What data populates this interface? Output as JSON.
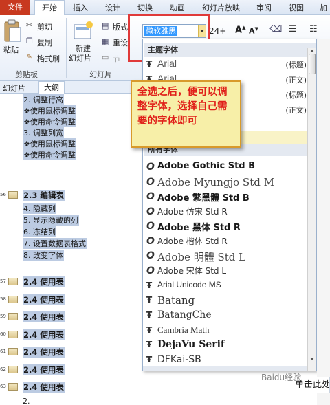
{
  "ribbon_tabs": [
    {
      "label": "文件"
    },
    {
      "label": "开始"
    },
    {
      "label": "插入"
    },
    {
      "label": "设计"
    },
    {
      "label": "切换"
    },
    {
      "label": "动画"
    },
    {
      "label": "幻灯片放映"
    },
    {
      "label": "审阅"
    },
    {
      "label": "视图"
    },
    {
      "label": "加"
    }
  ],
  "clipboard": {
    "paste": "粘贴",
    "cut": "剪切",
    "copy": "复制",
    "format_painter": "格式刷",
    "group": "剪贴板"
  },
  "slides_group": {
    "new_slide": "新建",
    "new_slide2": "幻灯片",
    "layout": "版式",
    "reset": "重设",
    "section": "节",
    "group": "幻灯片"
  },
  "font_box": {
    "value": "微软雅黑",
    "size": "24+"
  },
  "panel_tabs": {
    "slides": "幻灯片",
    "outline": "大纲"
  },
  "outline": [
    {
      "text": "2. 调整行高",
      "hl": true,
      "bold": false,
      "kind": "text"
    },
    {
      "text": "❖使用鼠标调整",
      "hl": true,
      "bold": false,
      "kind": "text"
    },
    {
      "text": "❖使用命令调整",
      "hl": true,
      "bold": false,
      "kind": "text"
    },
    {
      "text": "3. 调整列宽",
      "hl": true,
      "bold": false,
      "kind": "text"
    },
    {
      "text": "❖使用鼠标调整",
      "hl": true,
      "bold": false,
      "kind": "text"
    },
    {
      "text": "❖使用命令调整",
      "hl": true,
      "bold": false,
      "kind": "text"
    },
    {
      "text": "2.3 编辑表",
      "hl": true,
      "bold": true,
      "kind": "slide",
      "num": "56"
    },
    {
      "text": "4. 隐藏列",
      "hl": true,
      "bold": false,
      "kind": "text"
    },
    {
      "text": "5. 显示隐藏的列",
      "hl": true,
      "bold": false,
      "kind": "text"
    },
    {
      "text": "6. 冻结列",
      "hl": true,
      "bold": false,
      "kind": "text"
    },
    {
      "text": "7. 设置数据表格式",
      "hl": true,
      "bold": false,
      "kind": "text"
    },
    {
      "text": "8. 改变字体",
      "hl": true,
      "bold": false,
      "kind": "text"
    },
    {
      "text": "2.4 使用表",
      "hl": true,
      "bold": true,
      "kind": "slide",
      "num": "57"
    },
    {
      "text": "2.4 使用表",
      "hl": true,
      "bold": true,
      "kind": "slide",
      "num": "58"
    },
    {
      "text": "2.4 使用表",
      "hl": true,
      "bold": true,
      "kind": "slide",
      "num": "59"
    },
    {
      "text": "2.4 使用表",
      "hl": true,
      "bold": true,
      "kind": "slide",
      "num": "60"
    },
    {
      "text": "2.4 使用表",
      "hl": true,
      "bold": true,
      "kind": "slide",
      "num": "61"
    },
    {
      "text": "2.4 使用表",
      "hl": true,
      "bold": true,
      "kind": "slide",
      "num": "62"
    },
    {
      "text": "2.4 使用表",
      "hl": true,
      "bold": true,
      "kind": "slide",
      "num": "63"
    },
    {
      "text": "2.",
      "hl": false,
      "bold": false,
      "kind": "text"
    }
  ],
  "dropdown": {
    "theme_header": "主题字体",
    "theme_fonts": [
      {
        "name": "Arial",
        "tag": "(标题)"
      },
      {
        "name": "Arial",
        "tag": "(正文)"
      },
      {
        "name": "",
        "tag": "(标题)"
      },
      {
        "name": "",
        "tag": "(正文)"
      }
    ],
    "all_header": "所有字体",
    "fonts": [
      {
        "name": "Adobe Gothic Std B",
        "icon": "O"
      },
      {
        "name": "Adobe Myungjo Std M",
        "icon": "O"
      },
      {
        "name": "Adobe 繁黑體 Std B",
        "icon": "O"
      },
      {
        "name": "Adobe 仿宋 Std R",
        "icon": "O"
      },
      {
        "name": "Adobe 黑体 Std R",
        "icon": "O"
      },
      {
        "name": "Adobe 楷体 Std R",
        "icon": "O"
      },
      {
        "name": "Adobe 明體 Std L",
        "icon": "O"
      },
      {
        "name": "Adobe 宋体 Std L",
        "icon": "O"
      },
      {
        "name": "Arial Unicode MS",
        "icon": "T"
      },
      {
        "name": "Batang",
        "icon": "T"
      },
      {
        "name": "BatangChe",
        "icon": "T"
      },
      {
        "name": "Cambria Math",
        "icon": "T"
      },
      {
        "name": "DejaVu Serif",
        "icon": "T"
      },
      {
        "name": "DFKai-SB",
        "icon": "T"
      }
    ]
  },
  "callout": {
    "text": "全选之后，便可以调整字体，选择自己需要的字体即可"
  },
  "notes_prompt": "单击此处",
  "watermark": "Baidu经验"
}
